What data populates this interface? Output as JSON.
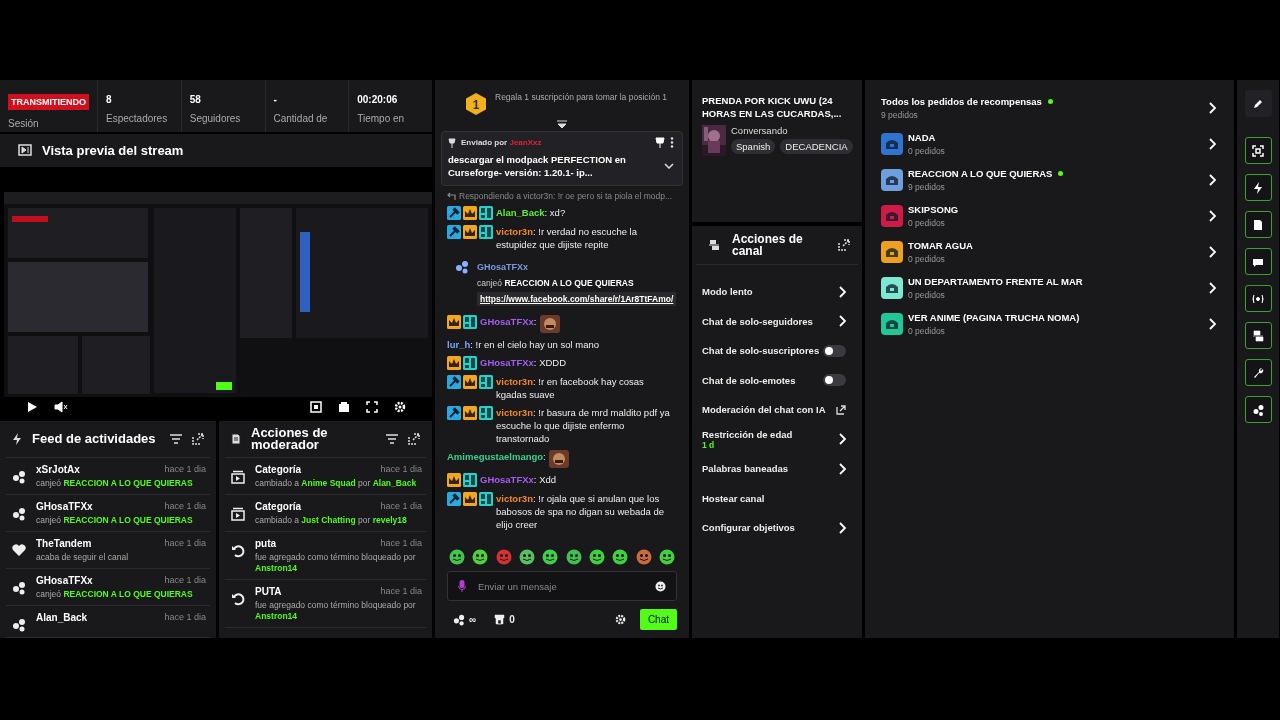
{
  "stats": {
    "live_badge": "TRANSMITIENDO",
    "session_label": "Sesión",
    "items": [
      {
        "value": "8",
        "label": "Espectadores"
      },
      {
        "value": "58",
        "label": "Seguidores"
      },
      {
        "value": "-",
        "label": "Cantidad de"
      },
      {
        "value": "00:20:06",
        "label": "Tiempo en"
      }
    ]
  },
  "preview": {
    "title": "Vista previa del stream"
  },
  "feed": {
    "title": "Feed de actividades",
    "items": [
      {
        "kind": "redeem",
        "user": "xSrJotAx",
        "time": "hace 1 dia",
        "text": "canjeó ",
        "highlight": "REACCION A LO QUE QUIERAS"
      },
      {
        "kind": "redeem",
        "user": "GHosaTFXx",
        "time": "hace 1 dia",
        "text": "canjeó ",
        "highlight": "REACCION A LO QUE QUIERAS"
      },
      {
        "kind": "follow",
        "user": "TheTandem",
        "time": "hace 1 dia",
        "text": "acaba de seguir el canal"
      },
      {
        "kind": "redeem",
        "user": "GHosaTFXx",
        "time": "hace 1 dia",
        "text": "canjeó ",
        "highlight": "REACCION A LO QUE QUIERAS"
      },
      {
        "kind": "redeem",
        "user": "Alan_Back",
        "time": "hace 1 dia"
      }
    ]
  },
  "mod": {
    "title": "Acciones de moderador",
    "items": [
      {
        "kind": "category",
        "title": "Categoría",
        "time": "hace 1 dia",
        "parts": [
          {
            "text": "cambiado a ",
            "hl": false
          },
          {
            "text": "Anime Squad",
            "hl": true
          },
          {
            "text": " por ",
            "hl": false
          },
          {
            "text": "Alan_Back",
            "hl": true
          }
        ]
      },
      {
        "kind": "category",
        "title": "Categoría",
        "time": "hace 1 dia",
        "parts": [
          {
            "text": "cambiado a ",
            "hl": false
          },
          {
            "text": "Just Chatting",
            "hl": true
          },
          {
            "text": " por ",
            "hl": false
          },
          {
            "text": "revely18",
            "hl": true
          }
        ]
      },
      {
        "kind": "blocked",
        "title": "puta",
        "time": "hace 1 dia",
        "parts": [
          {
            "text": "fue agregado como término bloqueado por ",
            "hl": false
          },
          {
            "text": "Anstron14",
            "hl": true
          }
        ]
      },
      {
        "kind": "blocked",
        "title": "PUTA",
        "time": "hace 1 dia",
        "parts": [
          {
            "text": "fue agregado como término bloqueado por ",
            "hl": false
          },
          {
            "text": "Anstron14",
            "hl": true
          }
        ]
      }
    ]
  },
  "chat": {
    "gift_rank": "1",
    "gift_text": "Regala 1 suscripción para tomar la posición 1",
    "pinned": {
      "label": "Enviado por",
      "user": "JeanXxz",
      "text": "descargar el modpack PERFECTION en Curseforge- versión: 1.20.1- ip..."
    },
    "messages": [
      {
        "kind": "reply",
        "text": "Respondiendo a victor3n: !r oe pero si ta piola el modp..."
      },
      {
        "kind": "message",
        "badges": [
          {
            "kind": "mod"
          },
          {
            "kind": "crown"
          },
          {
            "kind": "sub"
          }
        ],
        "user": "Alan_Back",
        "color": "#5cf03a",
        "text": ": xd?",
        "emote": false
      },
      {
        "kind": "message",
        "badges": [
          {
            "kind": "mod"
          },
          {
            "kind": "crown"
          },
          {
            "kind": "sub"
          }
        ],
        "user": "victor3n",
        "color": "#f0882a",
        "text": ": !r verdad no escuche la estupidez que dijiste repite",
        "emote": false
      },
      {
        "kind": "redeem",
        "user": "GHosaTFXx",
        "action": "canjeó ",
        "reward": "REACCION A LO QUE QUIERAS",
        "link": "https://www.facebook.com/share/r/1Ar8TtFAmo/"
      },
      {
        "kind": "message",
        "badges": [
          {
            "kind": "crown"
          },
          {
            "kind": "sub"
          }
        ],
        "user": "GHosaTFXx",
        "color": "#a65cf0",
        "text": ":",
        "emote": true
      },
      {
        "kind": "message",
        "user": "lur_h",
        "color": "#7aa6ff",
        "text": ": !r en el cielo hay un sol mano",
        "emote": false
      },
      {
        "kind": "message",
        "badges": [
          {
            "kind": "crown"
          },
          {
            "kind": "sub"
          }
        ],
        "user": "GHosaTFXx",
        "color": "#a65cf0",
        "text": ": XDDD",
        "emote": false
      },
      {
        "kind": "message",
        "badges": [
          {
            "kind": "mod"
          },
          {
            "kind": "crown"
          },
          {
            "kind": "sub"
          }
        ],
        "user": "victor3n",
        "color": "#f0882a",
        "text": ": !r en facebook hay cosas kgadas suave",
        "emote": false
      },
      {
        "kind": "message",
        "badges": [
          {
            "kind": "mod"
          },
          {
            "kind": "crown"
          },
          {
            "kind": "sub"
          }
        ],
        "user": "victor3n",
        "color": "#f0882a",
        "text": ": !r basura de mrd maldito pdf ya escuche lo que dijiste enfermo transtornado",
        "emote": false
      },
      {
        "kind": "message",
        "user": "Amimegustaelmango",
        "color": "#3ccf8e",
        "text": ":",
        "emote": true
      },
      {
        "kind": "message",
        "badges": [
          {
            "kind": "crown"
          },
          {
            "kind": "sub"
          }
        ],
        "user": "GHosaTFXx",
        "color": "#a65cf0",
        "text": ": Xdd",
        "emote": false
      },
      {
        "kind": "message",
        "badges": [
          {
            "kind": "mod"
          },
          {
            "kind": "crown"
          },
          {
            "kind": "sub"
          }
        ],
        "user": "victor3n",
        "color": "#f0882a",
        "text": ": !r ojala que si anulan que los babosos de spa no digan su webada de elijo creer",
        "emote": false
      }
    ],
    "emotes": [
      {
        "color": "#3fc94a"
      },
      {
        "color": "#4fd13a"
      },
      {
        "color": "#d83030"
      },
      {
        "color": "#58c060"
      },
      {
        "color": "#3fd04a"
      },
      {
        "color": "#40c050"
      },
      {
        "color": "#3fd040"
      },
      {
        "color": "#40d040"
      },
      {
        "color": "#c86a3a"
      },
      {
        "color": "#40d040"
      }
    ],
    "placeholder": "Enviar un mensaje",
    "points": "∞",
    "store_count": "0",
    "send": "Chat"
  },
  "stream": {
    "title": "PRENDA POR KICK UWU (24 HORAS EN LAS CUCARDAS,...",
    "category": "Conversando",
    "tags": [
      "Spanish",
      "DECADENCIA"
    ]
  },
  "actions": {
    "title": "Acciones de canal",
    "items": [
      {
        "kind": "arrow",
        "label": "Modo lento"
      },
      {
        "kind": "arrow",
        "label": "Chat de solo-seguidores"
      },
      {
        "kind": "toggle",
        "label": "Chat de solo-suscriptores",
        "on": false
      },
      {
        "kind": "toggle",
        "label": "Chat de solo-emotes",
        "on": false
      },
      {
        "kind": "external",
        "label": "Moderación del chat con IA"
      },
      {
        "kind": "arrow",
        "label": "Restricción de edad",
        "sub": "1 d"
      },
      {
        "kind": "arrow",
        "label": "Palabras baneadas"
      },
      {
        "kind": "plain",
        "label": "Hostear canal"
      },
      {
        "kind": "arrow",
        "label": "Configurar objetivos"
      }
    ]
  },
  "rewards": [
    {
      "kind": "all",
      "name": "Todos los pedidos de recompensas",
      "count": "9 pedidos",
      "live": true
    },
    {
      "kind": "reward",
      "name": "NADA",
      "count": "0 pedidos",
      "color": "#2f74d0",
      "live": false
    },
    {
      "kind": "reward",
      "name": "REACCION A LO QUE QUIERAS",
      "count": "9 pedidos",
      "color": "#6ea0e0",
      "live": true
    },
    {
      "kind": "reward",
      "name": "SKIPSONG",
      "count": "0 pedidos",
      "color": "#d01a48",
      "live": false
    },
    {
      "kind": "reward",
      "name": "TOMAR AGUA",
      "count": "0 pedidos",
      "color": "#f0a020",
      "live": false
    },
    {
      "kind": "reward",
      "name": "UN DEPARTAMENTO FRENTE AL MAR",
      "count": "0 pedidos",
      "color": "#7ee8d0",
      "live": false
    },
    {
      "kind": "reward",
      "name": "VER ANIME (PAGINA TRUCHA NOMA)",
      "count": "0 pedidos",
      "color": "#20c898",
      "live": false
    }
  ],
  "sidebar": [
    {
      "kind": "edit",
      "on": false
    },
    {
      "kind": "focus",
      "on": true
    },
    {
      "kind": "bolt",
      "on": true
    },
    {
      "kind": "doc",
      "on": true
    },
    {
      "kind": "chat",
      "on": true
    },
    {
      "kind": "broadcast",
      "on": true
    },
    {
      "kind": "actions",
      "on": true
    },
    {
      "kind": "wrench",
      "on": true
    },
    {
      "kind": "dots",
      "on": true
    }
  ]
}
